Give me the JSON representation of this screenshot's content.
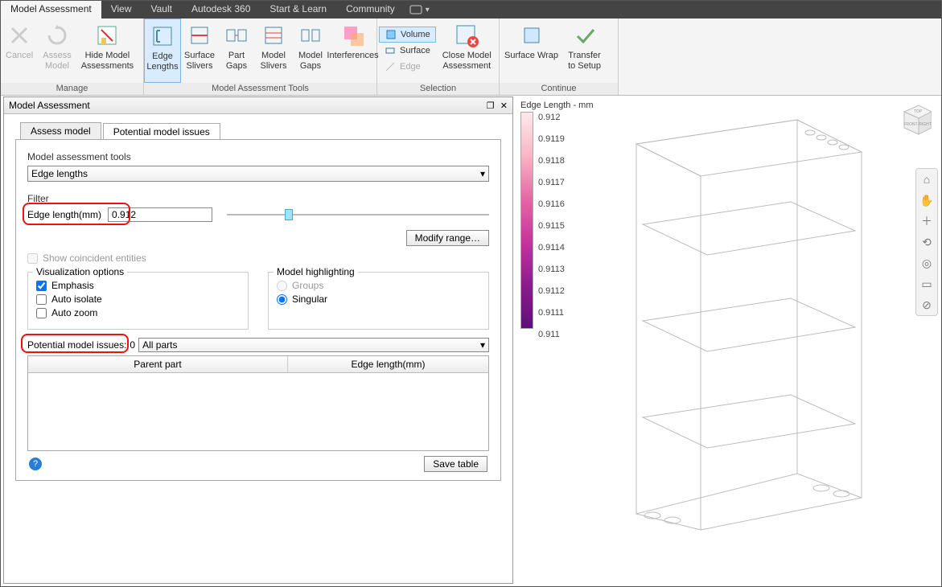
{
  "menu": {
    "tabs": [
      "Model Assessment",
      "View",
      "Vault",
      "Autodesk 360",
      "Start & Learn",
      "Community"
    ],
    "active": 0
  },
  "ribbon": {
    "manage": {
      "cancel": "Cancel",
      "assess_model": "Assess\nModel",
      "hide": "Hide Model\nAssessments",
      "label": "Manage"
    },
    "tools": {
      "edge_lengths": "Edge\nLengths",
      "surface_slivers": "Surface\nSlivers",
      "part_gaps": "Part\nGaps",
      "model_slivers": "Model\nSlivers",
      "model_gaps": "Model\nGaps",
      "interferences": "Interferences",
      "label": "Model Assessment Tools"
    },
    "selection": {
      "volume": "Volume",
      "surface": "Surface",
      "edge": "Edge",
      "close": "Close Model\nAssessment",
      "label": "Selection"
    },
    "continue": {
      "surface_wrap": "Surface Wrap",
      "transfer": "Transfer\nto Setup",
      "label": "Continue"
    }
  },
  "panel": {
    "title": "Model Assessment",
    "tabs": {
      "assess": "Assess model",
      "issues": "Potential model issues"
    },
    "tools_label": "Model assessment tools",
    "tools_value": "Edge lengths",
    "filter_label": "Filter",
    "edge_length_label": "Edge length(mm)",
    "edge_length_value": "0.912",
    "modify_range": "Modify range…",
    "show_coincident": "Show coincident entities",
    "viz_label": "Visualization options",
    "viz": {
      "emphasis": "Emphasis",
      "auto_isolate": "Auto isolate",
      "auto_zoom": "Auto zoom"
    },
    "highlight_label": "Model highlighting",
    "highlight": {
      "groups": "Groups",
      "singular": "Singular"
    },
    "issues_label": "Potential model issues:",
    "issues_count": "0",
    "parts_value": "All parts",
    "grid": {
      "col1": "Parent part",
      "col2": "Edge length(mm)"
    },
    "save_table": "Save table"
  },
  "viewport": {
    "legend_title": "Edge Length - mm",
    "ticks": [
      "0.912",
      "0.9119",
      "0.9118",
      "0.9117",
      "0.9116",
      "0.9115",
      "0.9114",
      "0.9113",
      "0.9112",
      "0.9111",
      "0.911"
    ],
    "cube": {
      "top": "TOP",
      "front": "FRONT",
      "right": "RIGHT"
    }
  }
}
